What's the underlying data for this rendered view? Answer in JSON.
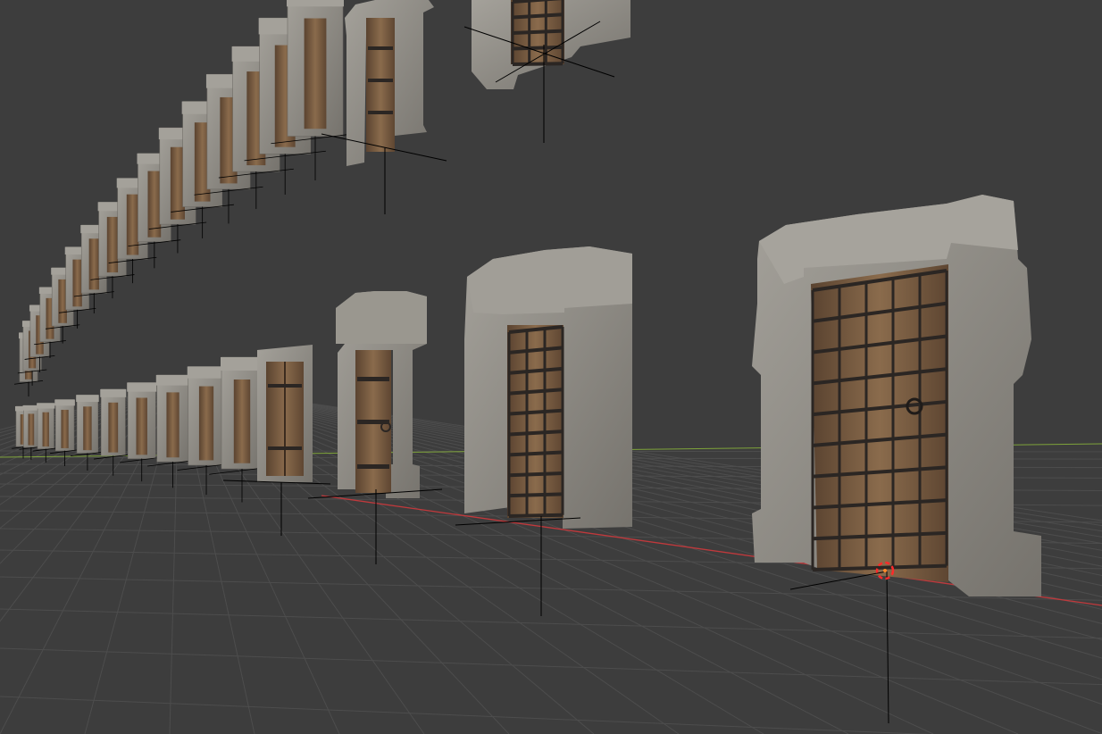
{
  "viewport": {
    "editor": "3D Viewport",
    "background_color": "#3d3d3d",
    "grid_color": "#4d4d4d",
    "x_axis_color": "#c0393c",
    "y_axis_color": "#7ea33a",
    "stone_color": "#8f8c85",
    "stone_dark_color": "#6f6c66",
    "wood_color": "#7a5e41",
    "iron_color": "#2b2623",
    "origin_marker_color": "#000000",
    "cursor_colors": [
      "#ff2a2a",
      "#ffffff"
    ]
  },
  "scene": {
    "objects": [
      {
        "name": "door-large-portcullis",
        "style": "portcullis",
        "count": 1
      },
      {
        "name": "door-medium-portcullis",
        "style": "portcullis",
        "count": 1
      },
      {
        "name": "door-arched-wood",
        "style": "banded-wood",
        "count": 1
      },
      {
        "name": "door-plain-wood",
        "style": "plank-wood",
        "count": 1
      },
      {
        "name": "door-row-lower-distant",
        "style": "stone-frame",
        "count": 10
      },
      {
        "name": "door-row-upper",
        "style": "stone-frame",
        "count": 16
      },
      {
        "name": "window-portcullis-upper",
        "style": "portcullis",
        "count": 1
      }
    ]
  }
}
